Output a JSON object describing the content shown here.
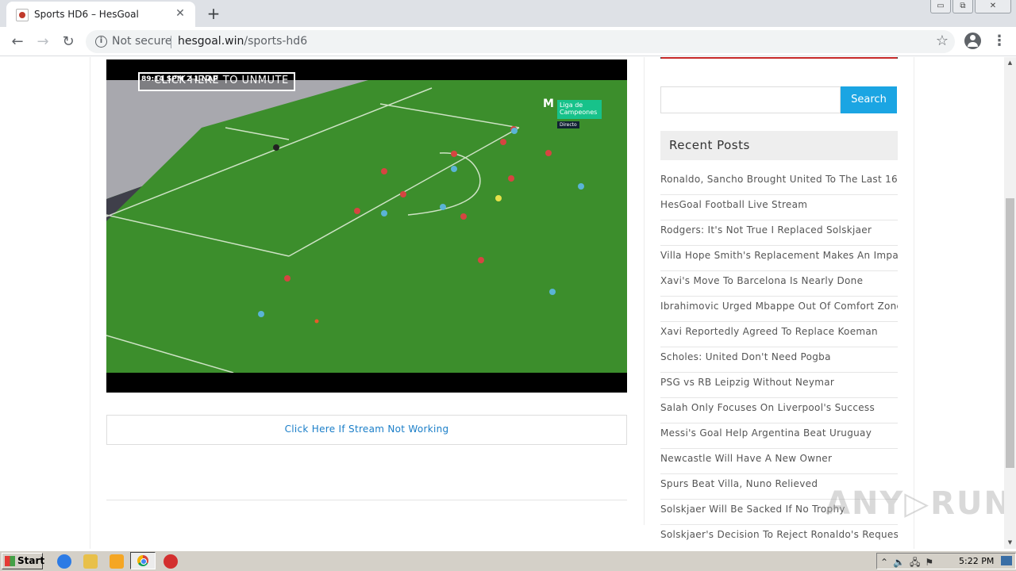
{
  "browser": {
    "tab_title": "Sports HD6 – HesGoal",
    "tab_close": "✕",
    "new_tab": "+",
    "not_secure": "Not secure",
    "url_domain": "hesgoal.win",
    "url_path": "/sports-hd6",
    "window_controls": [
      "▭",
      "⧉",
      "✕"
    ]
  },
  "nav": {
    "back": "←",
    "forward": "→",
    "reload": "↻",
    "menu": "⋮",
    "star": "☆"
  },
  "video": {
    "overlay_text": "CLICK HERE TO UNMUTE",
    "score_strip": "89:14   SPM   2   1   NAP",
    "broadcaster_logo": "M",
    "broadcaster_text": "Liga de Campeones",
    "live_tag": "Directo"
  },
  "stream_link": "Click Here If Stream Not Working",
  "sidebar": {
    "search_placeholder": "",
    "search_button": "Search",
    "recent_title": "Recent Posts",
    "posts": [
      "Ronaldo, Sancho Brought United To The Last 16",
      "HesGoal Football Live Stream",
      "Rodgers: It's Not True I Replaced Solskjaer",
      "Villa Hope Smith's Replacement Makes An Impact",
      "Xavi's Move To Barcelona Is Nearly Done",
      "Ibrahimovic Urged Mbappe Out Of Comfort Zone",
      "Xavi Reportedly Agreed To Replace Koeman",
      "Scholes: United Don't Need Pogba",
      "PSG vs RB Leipzig Without Neymar",
      "Salah Only Focuses On Liverpool's Success",
      "Messi's Goal Help Argentina Beat Uruguay",
      "Newcastle Will Have A New Owner",
      "Spurs Beat Villa, Nuno Relieved",
      "Solskjaer Will Be Sacked If No Trophy",
      "Solskjaer's Decision To Reject Ronaldo's Request"
    ]
  },
  "watermark": "ANY▷RUN",
  "taskbar": {
    "start_label": "Start",
    "clock": "5:22 PM",
    "tray_icons": "⌃🔈🖧⚑"
  },
  "scrollbar": {
    "up": "▲",
    "down": "▼"
  }
}
